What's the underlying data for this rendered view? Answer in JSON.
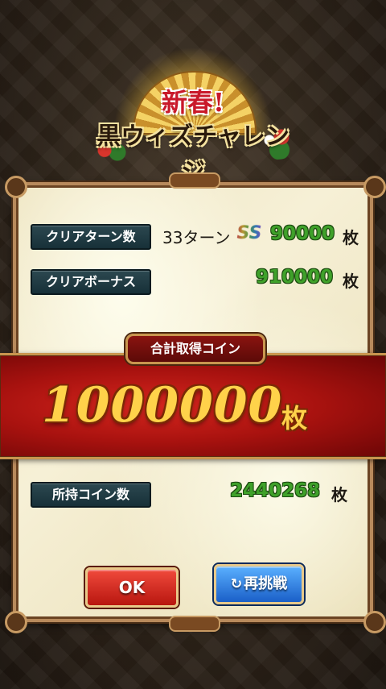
{
  "banner": {
    "title_line1": "新春!",
    "title_line2": "黒ウィズチャレンジ"
  },
  "results": {
    "clear_turns": {
      "label": "クリアターン数",
      "turns_text": "33ターン",
      "rank": "SS",
      "coins": "90000",
      "unit": "枚"
    },
    "clear_bonus": {
      "label": "クリアボーナス",
      "coins": "910000",
      "unit": "枚"
    }
  },
  "total": {
    "header": "合計取得コイン",
    "value": "1000000",
    "unit": "枚"
  },
  "owned": {
    "label": "所持コイン数",
    "value": "2440268",
    "unit": "枚"
  },
  "buttons": {
    "ok_label": "OK",
    "retry_label": "再挑戦",
    "retry_icon": "refresh-icon"
  },
  "colors": {
    "accent_red": "#c9192a",
    "coin_green": "#3fa12a",
    "total_gold": "#ffd24a",
    "label_teal": "#173038"
  }
}
